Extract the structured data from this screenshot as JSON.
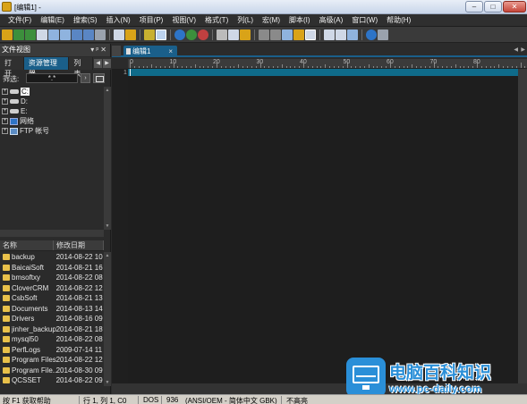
{
  "window": {
    "title": "[编辑1] -"
  },
  "menu": [
    "文件(F)",
    "编辑(E)",
    "搜索(S)",
    "插入(N)",
    "项目(P)",
    "视图(V)",
    "格式(T)",
    "列(L)",
    "宏(M)",
    "脚本(I)",
    "高级(A)",
    "窗口(W)",
    "帮助(H)"
  ],
  "left_panel": {
    "title": "文件视图",
    "tabs": [
      "打开",
      "资源管理器",
      "列表"
    ],
    "active_tab": "资源管理器",
    "filter_label": "筛选:",
    "filter_value": "*.*",
    "tree": [
      {
        "label": "C:",
        "icon": "drive-icon",
        "selected": true
      },
      {
        "label": "D:",
        "icon": "drive-icon"
      },
      {
        "label": "E:",
        "icon": "drive-icon"
      },
      {
        "label": "网络",
        "icon": "network-icon"
      },
      {
        "label": "FTP 帐号",
        "icon": "ftp-icon"
      }
    ],
    "columns": [
      "名称",
      "修改日期"
    ],
    "files": [
      {
        "name": "backup",
        "date": "2014-08-22 10"
      },
      {
        "name": "BaicaiSoft",
        "date": "2014-08-21 16"
      },
      {
        "name": "bmsoftxy",
        "date": "2014-08-22 08"
      },
      {
        "name": "CloverCRM",
        "date": "2014-08-22 12"
      },
      {
        "name": "CsbSoft",
        "date": "2014-08-21 13"
      },
      {
        "name": "Documents",
        "date": "2014-08-13 14"
      },
      {
        "name": "Drivers",
        "date": "2014-08-16 09"
      },
      {
        "name": "jinher_backup",
        "date": "2014-08-21 18"
      },
      {
        "name": "mysql50",
        "date": "2014-08-22 08"
      },
      {
        "name": "PerfLogs",
        "date": "2009-07-14 11"
      },
      {
        "name": "Program Files",
        "date": "2014-08-22 12"
      },
      {
        "name": "Program File...",
        "date": "2014-08-30 09"
      },
      {
        "name": "QCSSET",
        "date": "2014-08-22 09"
      }
    ]
  },
  "editor": {
    "tab_label": "编辑1",
    "tab_close": "×",
    "line_number": "1",
    "ruler_labels": [
      "0",
      "10",
      "20",
      "30",
      "40",
      "50",
      "60",
      "70",
      "80"
    ]
  },
  "status": {
    "help": "按 F1 获取帮助",
    "position": "行 1, 列 1, C0",
    "line_ending": "DOS",
    "codepage": "936",
    "encoding": "(ANSI/OEM - 简体中文 GBK)",
    "highlight": "不高亮"
  },
  "watermark": {
    "brand": "电脑百科知识",
    "url": "www.pc-daily.com"
  },
  "colors": {
    "accent": "#1a5f8a",
    "editor_bg": "#1e1e1e",
    "current_line": "#0f6b8a",
    "watermark_blue": "#2a8fd8"
  }
}
